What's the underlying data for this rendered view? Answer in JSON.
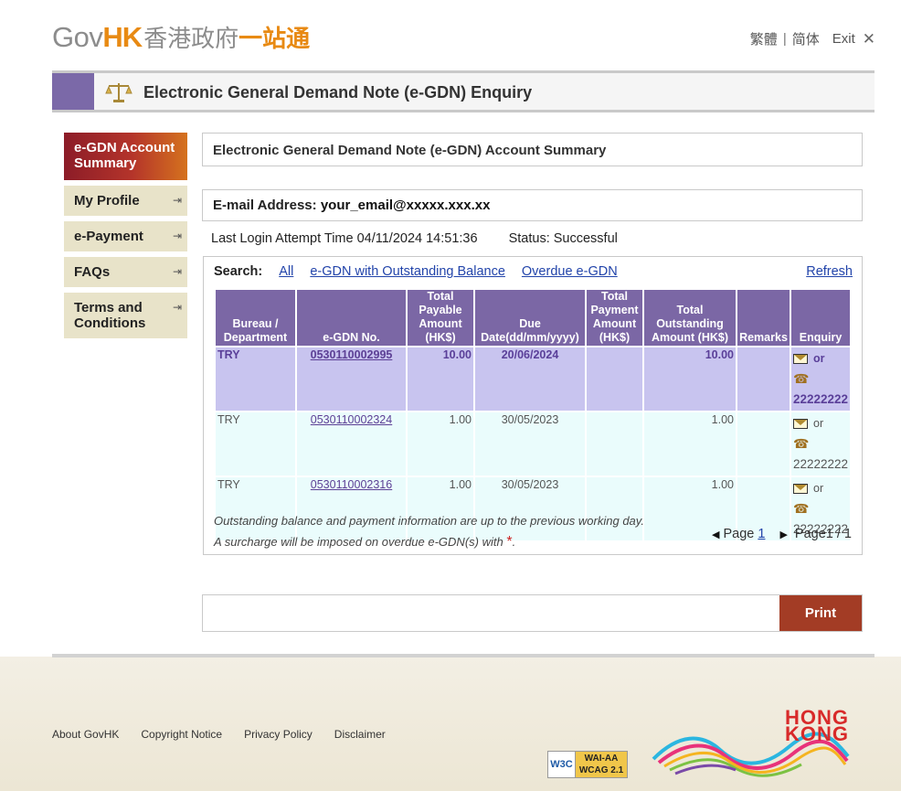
{
  "header": {
    "logo_en_gov": "Gov",
    "logo_en_hk": "HK",
    "logo_cn_1": "香港政府",
    "logo_cn_2": "一站通",
    "lang_trad": "繁體",
    "lang_simp": "简体",
    "exit_label": "Exit",
    "close_glyph": "✕"
  },
  "page_title": "Electronic General Demand Note (e-GDN) Enquiry",
  "sidebar": {
    "items": [
      {
        "label": "e-GDN Account Summary",
        "active": true
      },
      {
        "label": "My Profile"
      },
      {
        "label": "e-Payment"
      },
      {
        "label": "FAQs"
      },
      {
        "label": "Terms and Conditions"
      }
    ]
  },
  "summary_title": "Electronic General Demand Note (e-GDN) Account Summary",
  "email": {
    "label": "E-mail Address:",
    "value": "your_email@xxxxx.xxx.xx"
  },
  "login": {
    "text": "Last Login Attempt Time 04/11/2024 14:51:36",
    "status": "Status: Successful"
  },
  "search": {
    "label": "Search:",
    "all": "All",
    "outstanding": "e-GDN with Outstanding Balance",
    "overdue": "Overdue e-GDN",
    "refresh": "Refresh"
  },
  "table": {
    "headers": [
      "Bureau / Department",
      "e-GDN No.",
      "Total Payable Amount (HK$)",
      "Due Date(dd/mm/yyyy)",
      "Total Payment Amount (HK$)",
      "Total Outstanding Amount (HK$)",
      "Remarks",
      "Enquiry"
    ],
    "rows": [
      {
        "dept": "TRY",
        "no": "0530110002995",
        "payable": "10.00",
        "due": "20/06/2024",
        "payment": "",
        "outstanding": "10.00",
        "remarks": "",
        "or": "or",
        "phone": "22222222"
      },
      {
        "dept": "TRY",
        "no": "0530110002324",
        "payable": "1.00",
        "due": "30/05/2023",
        "payment": "",
        "outstanding": "1.00",
        "remarks": "",
        "or": "or",
        "phone": "22222222"
      },
      {
        "dept": "TRY",
        "no": "0530110002316",
        "payable": "1.00",
        "due": "30/05/2023",
        "payment": "",
        "outstanding": "1.00",
        "remarks": "",
        "or": "or",
        "phone": "22222222"
      }
    ]
  },
  "notes": {
    "line1": "Outstanding balance and payment information are up to the previous working day.",
    "line2": "A surcharge will be imposed on overdue e-GDN(s) with",
    "star": "*",
    "end": "."
  },
  "pager": {
    "page_label": "Page",
    "page_link": "1",
    "page_of": "Page1 / 1"
  },
  "print_label": "Print",
  "footer": {
    "links": [
      "About GovHK",
      "Copyright Notice",
      "Privacy Policy",
      "Disclaimer"
    ],
    "w3c": "W3C",
    "wai": "WAI-AA",
    "wcag": "WCAG 2.1",
    "hk1": "HONG",
    "hk2": "KONG"
  },
  "colors": {
    "accent_purple": "#7b67a5",
    "print_button": "#a33c25",
    "highlight_row": "#c8c4ef",
    "normal_row": "#eafcfc"
  }
}
